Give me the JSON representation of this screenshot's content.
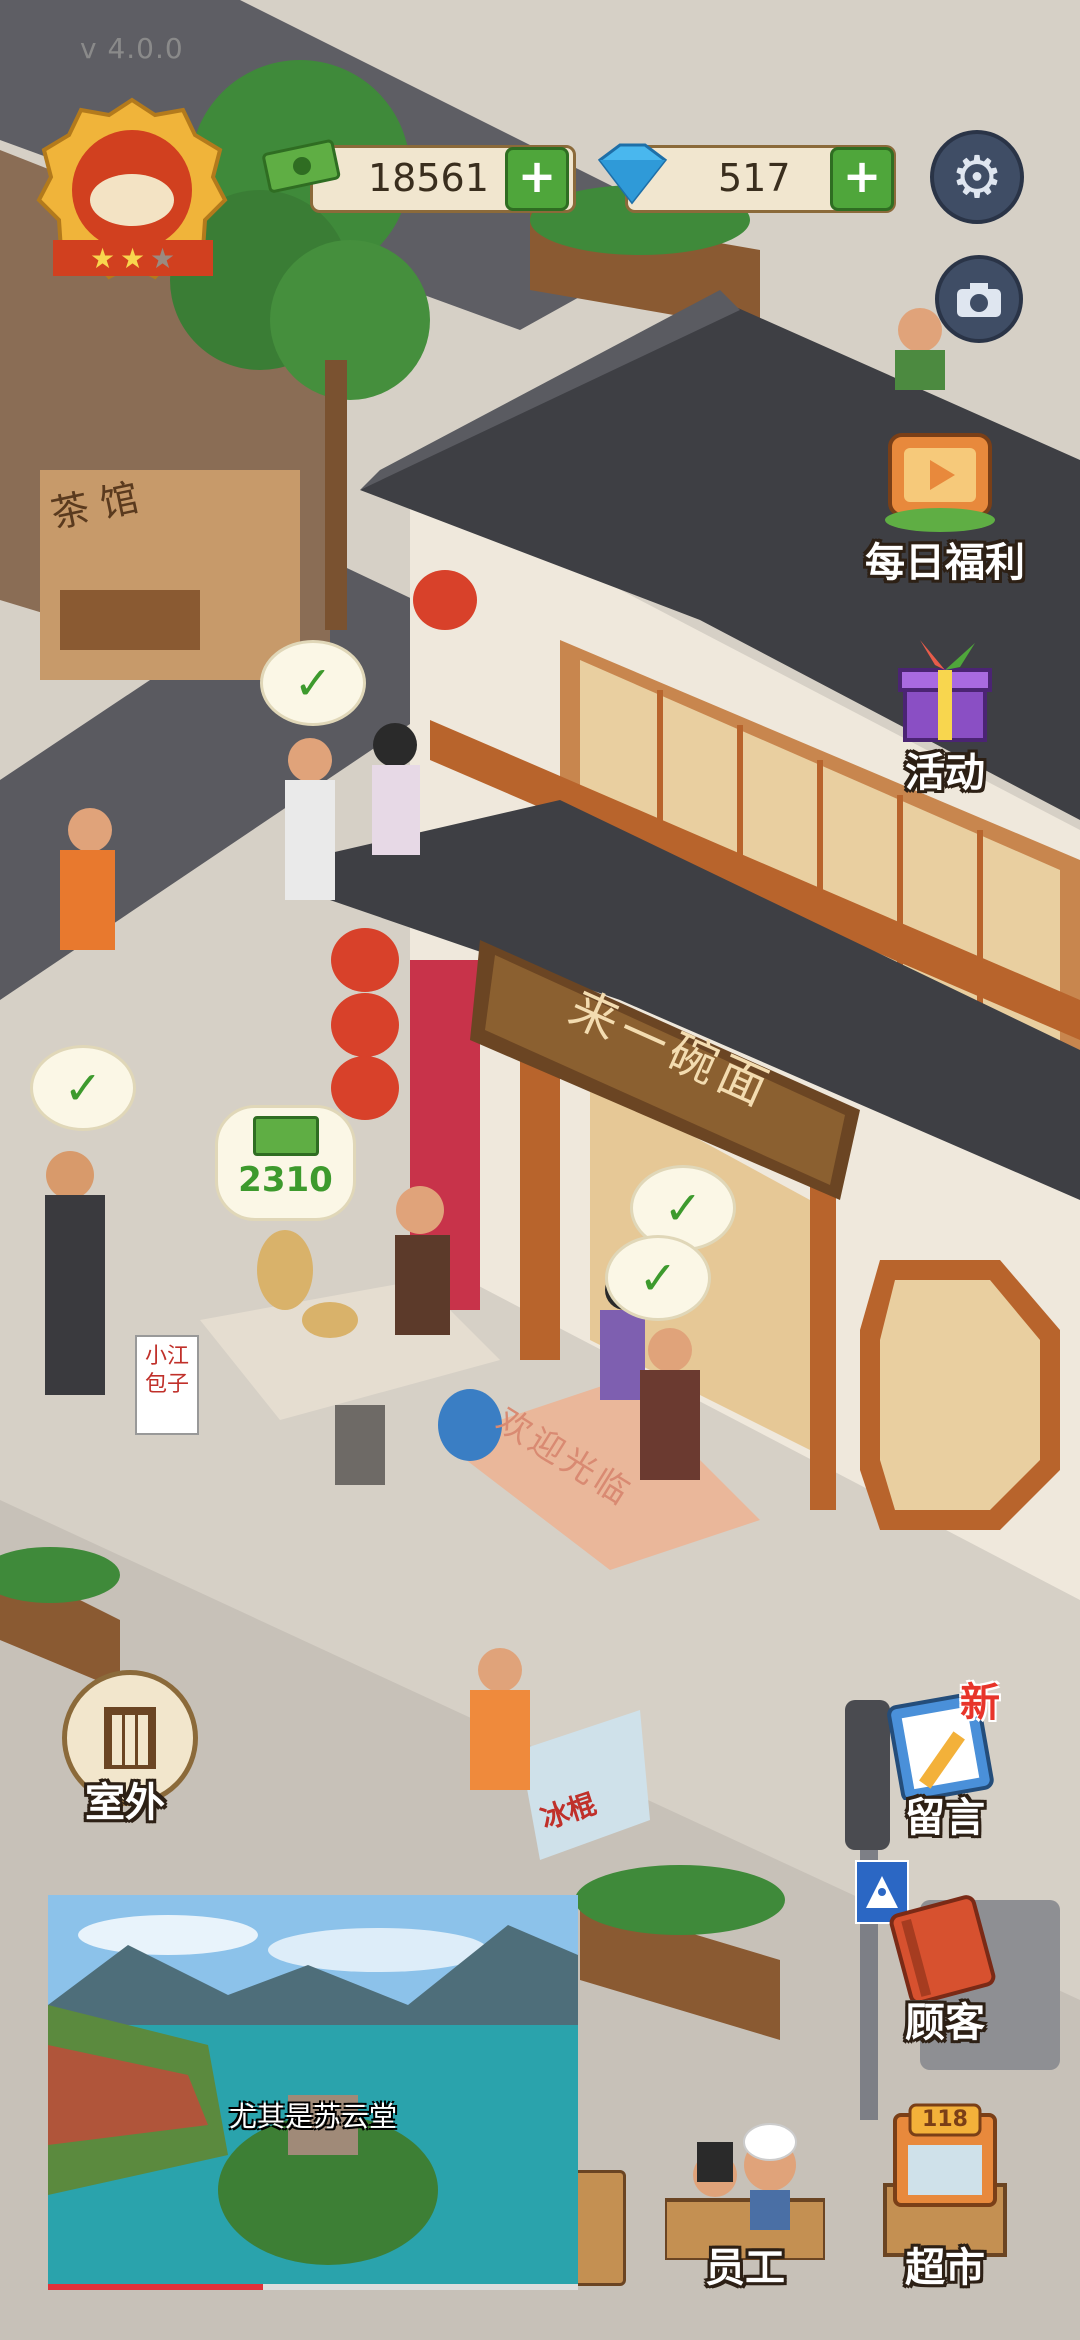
{
  "hud": {
    "version": "v 4.0.0",
    "cash": "18561",
    "diamonds": "517"
  },
  "right_menu": {
    "daily_welfare": "每日福利",
    "events": "活动",
    "message": "留言",
    "message_badge": "新",
    "customers": "顾客",
    "supermarket": "超市",
    "supermarket_sign": "118"
  },
  "left_menu": {
    "outdoor": "室外"
  },
  "bottom_menu": {
    "staff": "员工"
  },
  "scene": {
    "shop_sign": "来一碗面",
    "welcome_mat": "欢迎光临",
    "tea_house_sign": "茶 馆",
    "bun_stall_sign": "小江\n包子",
    "stall_earnings": "2310",
    "icebar_cart": "冰棍"
  },
  "video": {
    "subtitle": "尤其是苏云堂"
  },
  "colors": {
    "roof": "#3e3f44",
    "wood": "#b8642c",
    "accent_green": "#4fa63b",
    "lantern_red": "#d8412a"
  }
}
